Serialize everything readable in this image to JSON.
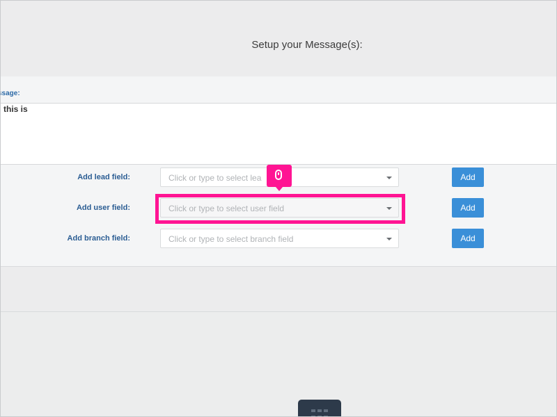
{
  "page": {
    "title": "Setup your Message(s):"
  },
  "message": {
    "label": "ssage:",
    "text": "this is"
  },
  "fields": [
    {
      "label": "Add lead field:",
      "placeholder": "Click or type to select lea",
      "button": "Add"
    },
    {
      "label": "Add user field:",
      "placeholder": "Click or type to select user field",
      "button": "Add"
    },
    {
      "label": "Add branch field:",
      "placeholder": "Click or type to select branch field",
      "button": "Add"
    }
  ],
  "icons": {
    "cursor_badge": "mouse-icon",
    "dock": "grid-icon",
    "dropdown": "chevron-down-icon"
  },
  "colors": {
    "accent": "#3a8fd8",
    "highlight": "#ff1493",
    "label": "#2b5d93",
    "dock": "#2d3a4a"
  }
}
